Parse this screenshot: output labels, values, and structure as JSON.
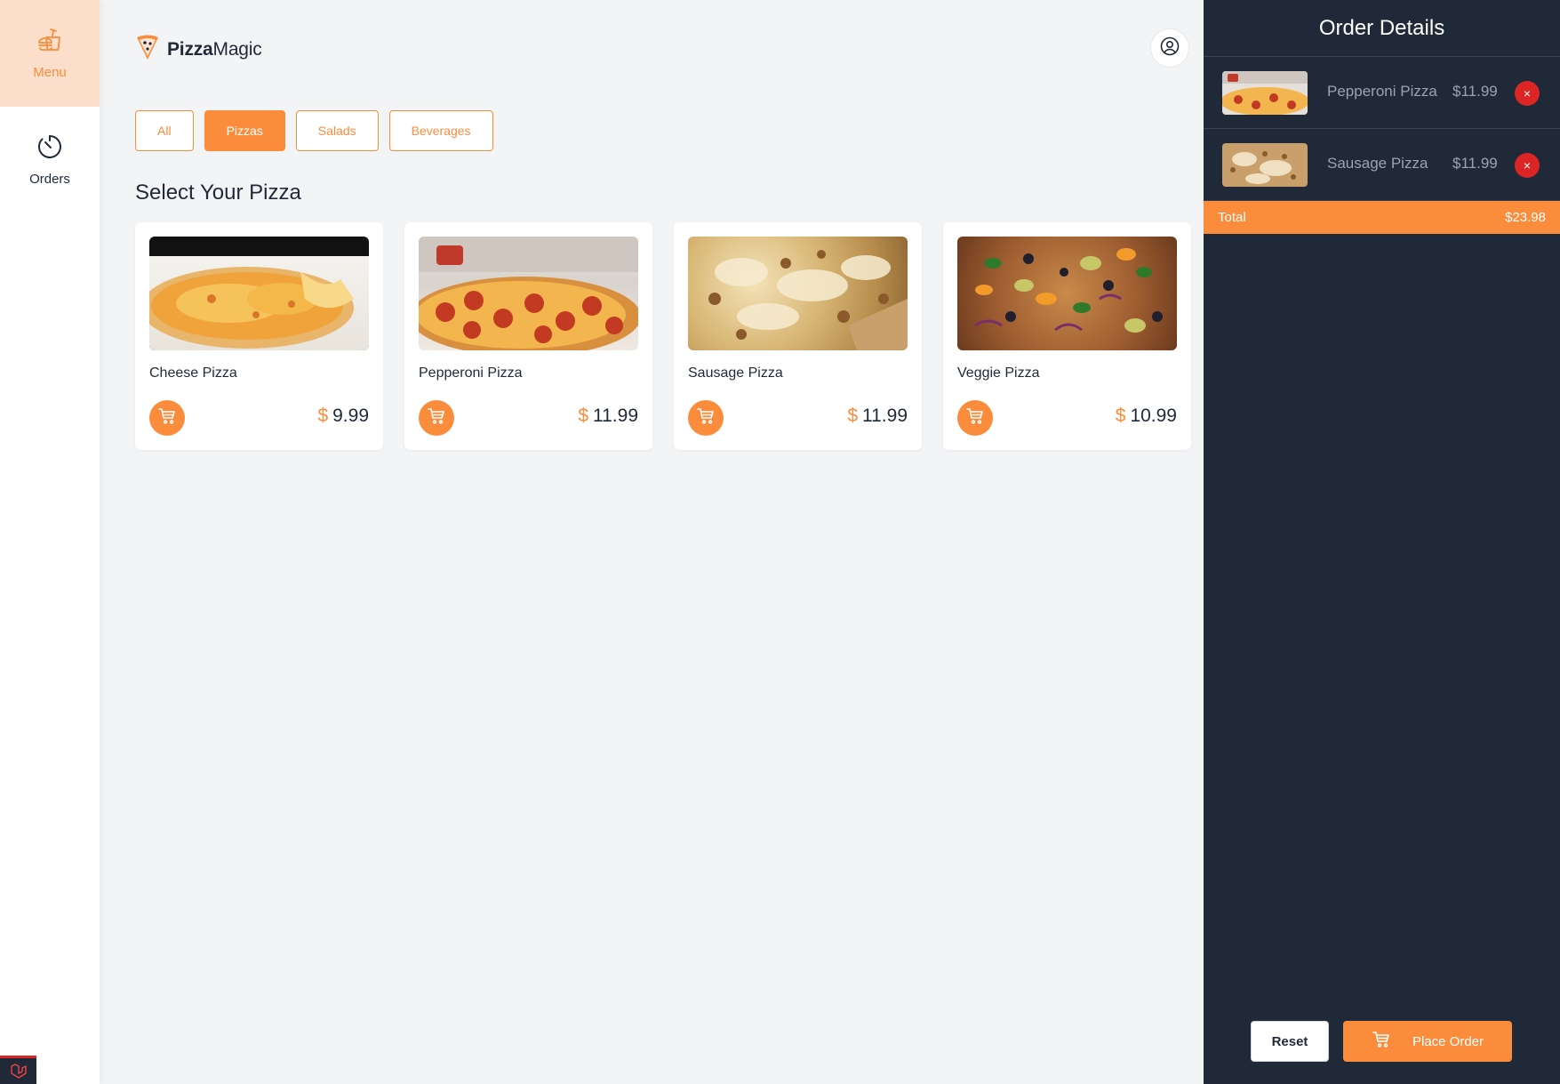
{
  "sidebar": {
    "items": [
      {
        "label": "Menu",
        "icon": "fastfood-icon",
        "active": true
      },
      {
        "label": "Orders",
        "icon": "timer-icon",
        "active": false
      }
    ]
  },
  "header": {
    "logo_bold": "Pizza",
    "logo_rest": "Magic",
    "profile_icon": "user-circle-icon"
  },
  "filters": [
    {
      "label": "All",
      "active": false
    },
    {
      "label": "Pizzas",
      "active": true
    },
    {
      "label": "Salads",
      "active": false
    },
    {
      "label": "Beverages",
      "active": false
    }
  ],
  "section_title": "Select Your Pizza",
  "products": [
    {
      "name": "Cheese Pizza",
      "currency": "$",
      "price": "9.99"
    },
    {
      "name": "Pepperoni Pizza",
      "currency": "$",
      "price": "11.99"
    },
    {
      "name": "Sausage Pizza",
      "currency": "$",
      "price": "11.99"
    },
    {
      "name": "Veggie Pizza",
      "currency": "$",
      "price": "10.99"
    }
  ],
  "order": {
    "title": "Order Details",
    "items": [
      {
        "name": "Pepperoni Pizza",
        "price": "$11.99",
        "remove": "×"
      },
      {
        "name": "Sausage Pizza",
        "price": "$11.99",
        "remove": "×"
      }
    ],
    "total_label": "Total",
    "total_value": "$23.98",
    "reset_label": "Reset",
    "place_label": "Place Order"
  },
  "colors": {
    "accent": "#fb8c3c",
    "panel_bg": "#1f2937",
    "danger": "#dc2626",
    "page_bg": "#f3f4f6"
  }
}
